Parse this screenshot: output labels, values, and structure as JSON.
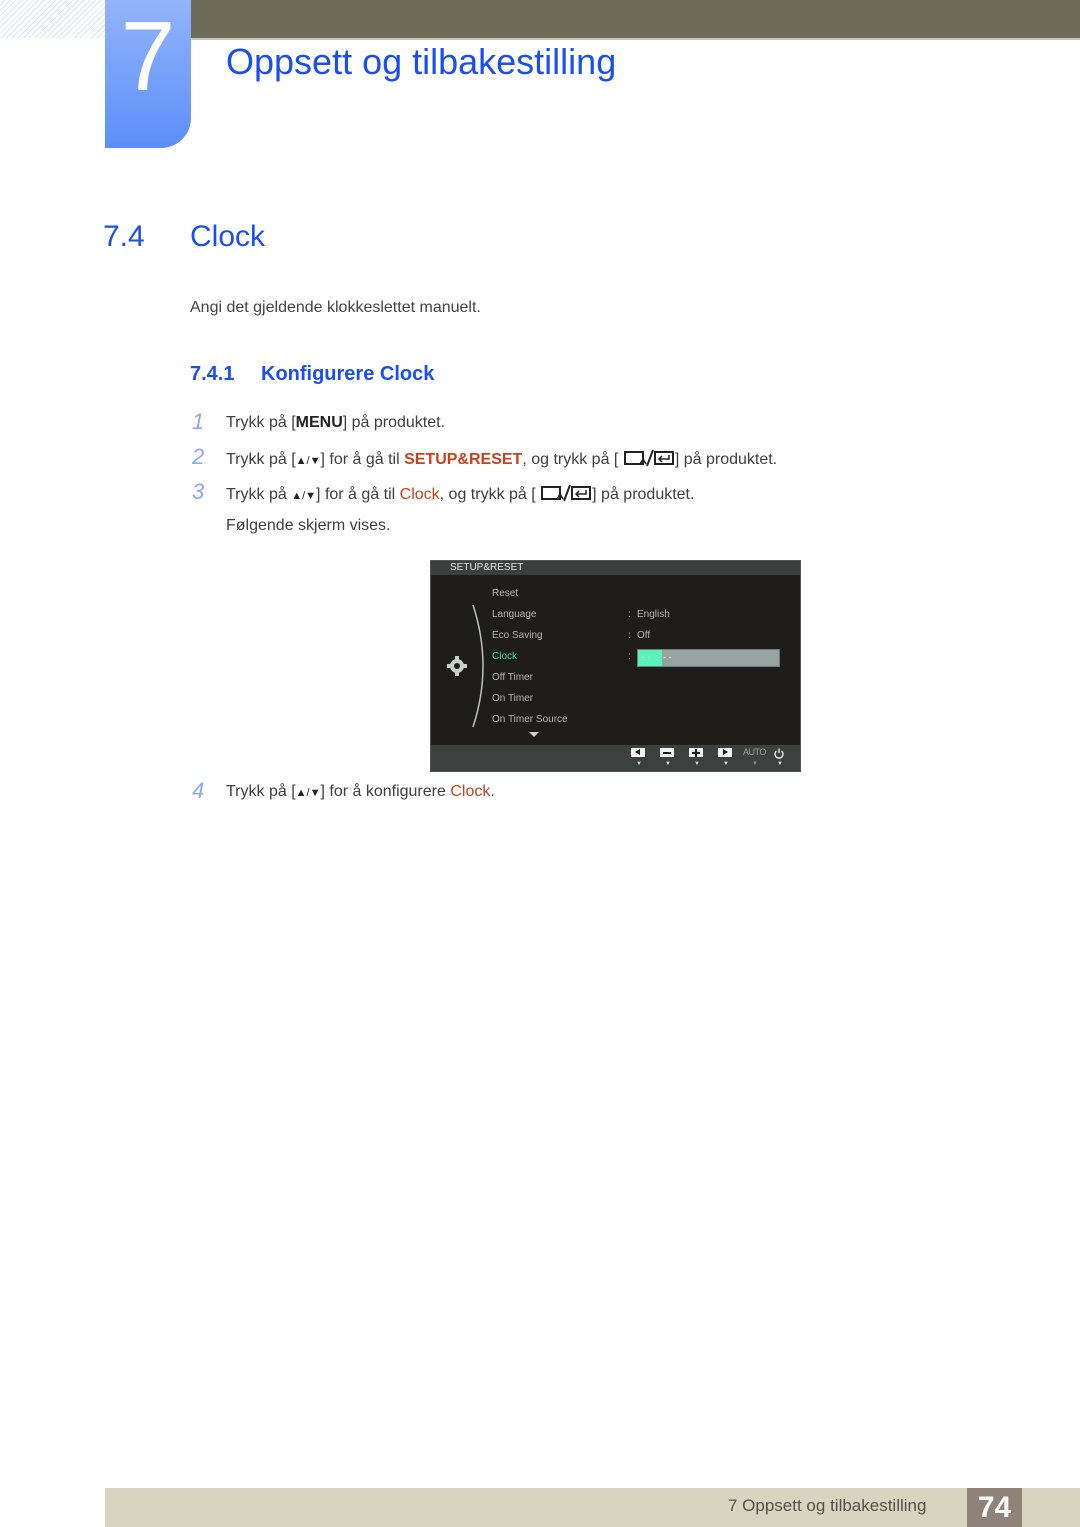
{
  "header": {
    "chapter_number": "7",
    "chapter_title": "Oppsett og tilbakestilling"
  },
  "section": {
    "number": "7.4",
    "title": "Clock",
    "intro": "Angi det gjeldende klokkeslettet manuelt."
  },
  "subsection": {
    "number": "7.4.1",
    "title": "Konfigurere Clock"
  },
  "steps": [
    {
      "num": "1",
      "t1": "Trykk på [",
      "key": "MENU",
      "t2": "] på produktet."
    },
    {
      "num": "2",
      "t1": "Trykk på [",
      "t2": "] for å gå til ",
      "kw": "SETUP&RESET",
      "t3": ", og trykk på [",
      "t4": "] på produktet."
    },
    {
      "num": "3",
      "t1": "Trykk på ",
      "t2": "] for å gå til ",
      "kw": "Clock",
      "t3": ", og trykk på [",
      "t4": "] på produktet.",
      "t5": "Følgende skjerm vises."
    },
    {
      "num": "4",
      "t1": "Trykk på [",
      "t2": "] for å konfigurere ",
      "kw": "Clock",
      "t3": "."
    }
  ],
  "icons": {
    "up_down": "▲/▼",
    "source_enter": "source-enter-icon"
  },
  "osd": {
    "title": "SETUP&RESET",
    "items": [
      {
        "label": "Reset",
        "value": ""
      },
      {
        "label": "Language",
        "value": "English"
      },
      {
        "label": "Eco Saving",
        "value": "Off"
      },
      {
        "label": "Clock",
        "value": "-- : --",
        "active": true
      },
      {
        "label": "Off Timer",
        "value": ""
      },
      {
        "label": "On Timer",
        "value": ""
      },
      {
        "label": "On Timer Source",
        "value": ""
      }
    ],
    "colon": ":",
    "clock_placeholder": "- -  :  - -",
    "auto_label": "AUTO",
    "active_color": "#3fd9a0",
    "buttons": [
      "left",
      "minus",
      "plus",
      "right",
      "auto",
      "power"
    ]
  },
  "footer": {
    "text": "7 Oppsett og tilbakestilling",
    "page": "74"
  },
  "colors": {
    "heading_blue": "#1a4ef0",
    "keyword_orange": "#c8421c",
    "header_bar": "#6e6c58",
    "footer_bar": "#d9d4bf",
    "page_box": "#8f8278"
  }
}
